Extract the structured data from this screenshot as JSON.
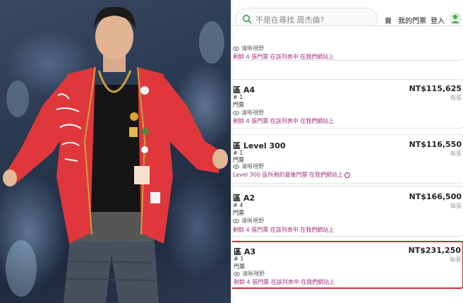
{
  "photo": {
    "subject": "man-in-red-jacket"
  },
  "search": {
    "placeholder": "不是在尋找 周杰倫?"
  },
  "nav": {
    "sell": "賣",
    "my_tickets": "我的門票",
    "login": "登入"
  },
  "listings": [
    {
      "delivery": "清晰視野",
      "notice": "剩餘 4 張門票  在該列表中  在我們網站上"
    },
    {
      "zone": "區 A4",
      "qty": "# 1",
      "kind": "門票",
      "delivery": "清晰視野",
      "notice": "剩餘 4 張門票  在該列表中  在我們網站上",
      "price": "NT$115,625",
      "each": "每張"
    },
    {
      "zone": "區 Level 300",
      "qty": "# 1",
      "kind": "門票",
      "delivery": "清晰視野",
      "notice": "Level 300 區所剩的最後門票  在我們網站上",
      "price": "NT$116,550",
      "each": "每張"
    },
    {
      "zone": "區 A2",
      "qty": "# 4",
      "kind": "門票",
      "delivery": "清晰視野",
      "notice": "剩餘 4 張門票  在該列表中  在我們網站上",
      "price": "NT$166,500",
      "each": "每張"
    },
    {
      "zone": "區 A3",
      "qty": "# 1",
      "kind": "門票",
      "delivery": "清晰視野",
      "notice": "剩餘 4 張門票  在該列表中  在我們網站上",
      "price": "NT$231,250",
      "each": "每張"
    }
  ],
  "colors": {
    "notice": "#a5307f",
    "highlight_border": "#c0343a",
    "jacket": "#e0373c",
    "avatar": "#4caf50"
  }
}
